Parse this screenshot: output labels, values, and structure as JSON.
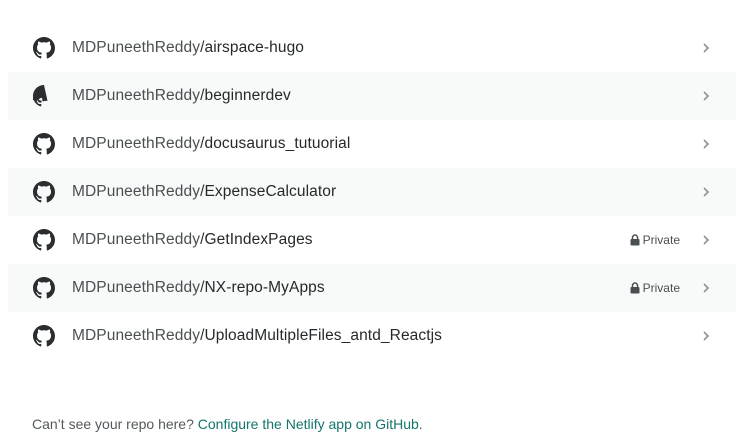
{
  "repos": [
    {
      "owner": "MDPuneethReddy",
      "name": "airspace-hugo",
      "private": false
    },
    {
      "owner": "MDPuneethReddy",
      "name": "beginnerdev",
      "private": false
    },
    {
      "owner": "MDPuneethReddy",
      "name": "docusaurus_tutuorial",
      "private": false
    },
    {
      "owner": "MDPuneethReddy",
      "name": "ExpenseCalculator",
      "private": false
    },
    {
      "owner": "MDPuneethReddy",
      "name": "GetIndexPages",
      "private": true
    },
    {
      "owner": "MDPuneethReddy",
      "name": "NX-repo-MyApps",
      "private": true
    },
    {
      "owner": "MDPuneethReddy",
      "name": "UploadMultipleFiles_antd_Reactjs",
      "private": false
    }
  ],
  "private_label": "Private",
  "separator": "/",
  "icons": {
    "repo": "github-icon",
    "private": "lock-icon",
    "row_action": "chevron-right-icon"
  },
  "footer": {
    "text": "Can’t see your repo here? ",
    "link_text": "Configure the Netlify app on GitHub",
    "end": "."
  },
  "colors": {
    "alt_row_bg": "#f8f9f9",
    "link": "#14766d",
    "text": "#4a4f52"
  }
}
